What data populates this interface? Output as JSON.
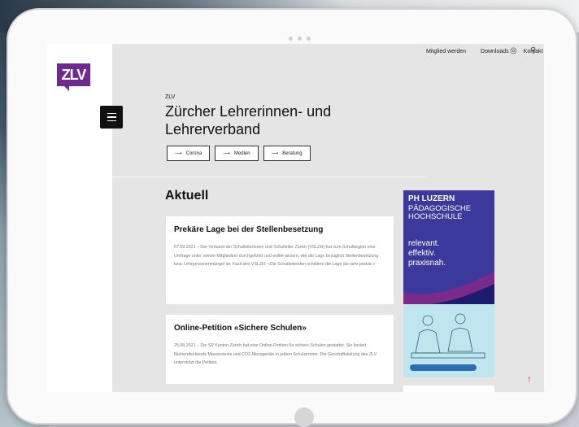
{
  "nav": {
    "links": [
      "Mitglied werden",
      "Downloads",
      "Kontakt"
    ]
  },
  "logo": {
    "text": "ZLV"
  },
  "header": {
    "kicker": "ZLV",
    "title": "Zürcher Lehrerinnen- und Lehrerverband"
  },
  "pills": [
    {
      "label": "Corona"
    },
    {
      "label": "Medien"
    },
    {
      "label": "Beratung"
    }
  ],
  "section": {
    "title": "Aktuell"
  },
  "cards": [
    {
      "title": "Prekäre Lage bei der Stellenbesetzung",
      "body": "07.09.2021 – Der Verband der Schulleiterinnen und Schulleiter Zürich (VSLZH) hat zum Schulbeginn eine Umfrage unter seinen Mitgliedern durchgeführt und wollte wissen, wie die Lage bezüglich Stellenbesetzung bzw. Lehrpersonenmangel ist. Fazit des VSLZH: «Die Schulleitenden schildern die Lage als sehr prekär.»"
    },
    {
      "title": "Online-Petition «Sichere Schulen»",
      "body": "25.08.2021 – Die SP Kanton Zürich hat eine Online-Petition für sichere Schulen gestartet. Sie fordert flächendeckende Massentests und CO2-Messgeräte in jedem Schulzimmer. Die Geschäftsleitung des ZLV unterstützt die Petition."
    }
  ],
  "ad": {
    "brand": "PH LUZERN",
    "subtitle": "PÄDAGOGISCHE HOCHSCHULE",
    "tagline": "relevant. effektiv. praxisnah."
  },
  "icons": [
    "user-icon",
    "search-icon",
    "menu-icon",
    "arrow-right-icon",
    "scroll-top-icon"
  ],
  "colors": {
    "brand": "#6e2a8e",
    "ad_bg": "#3b3a9c",
    "accent": "#e0342b"
  }
}
